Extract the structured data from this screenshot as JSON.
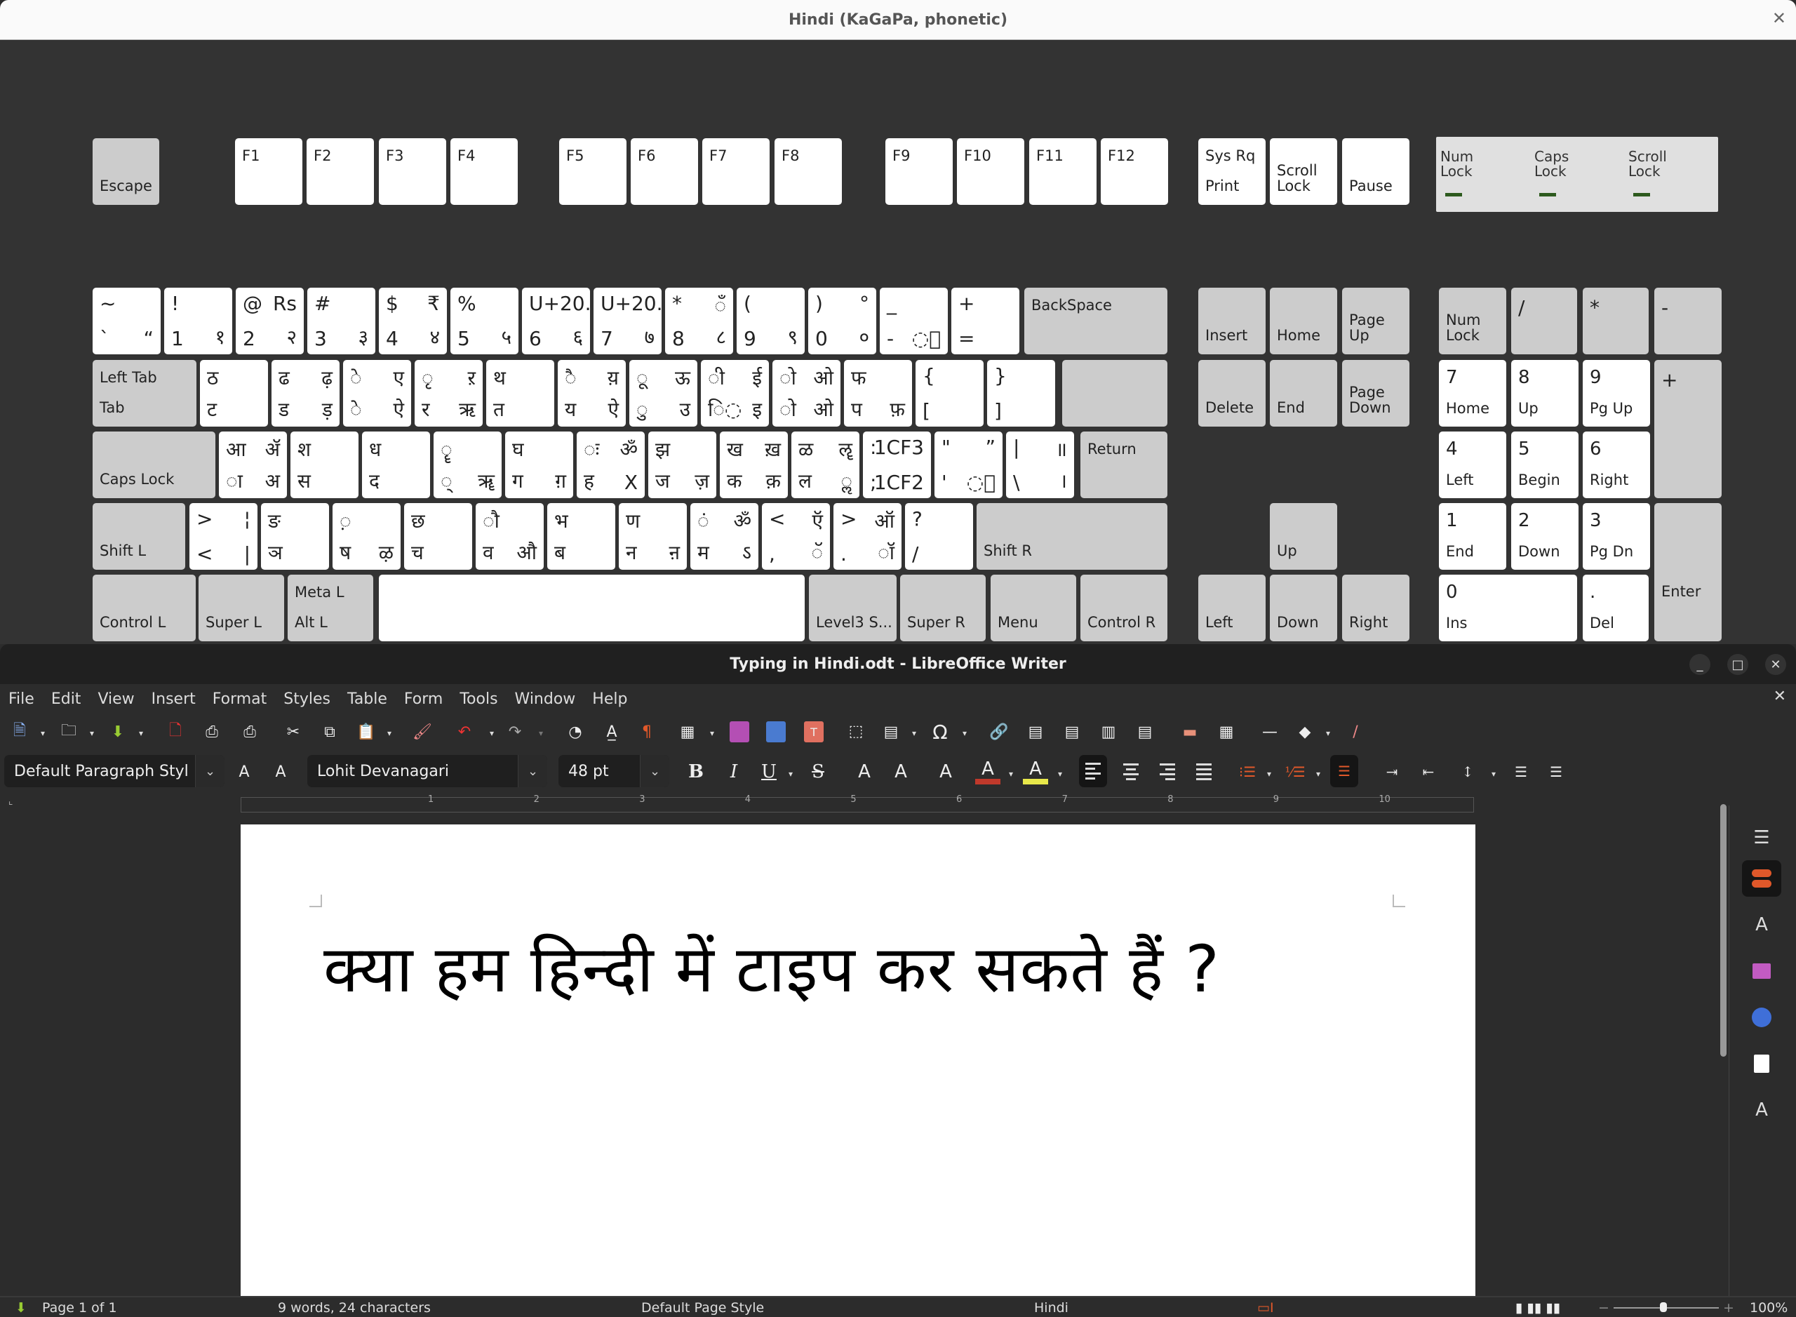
{
  "keyboard_window": {
    "title": "Hindi (KaGaPa, phonetic)",
    "close_icon": "close-icon",
    "function_row": [
      "Escape",
      "F1",
      "F2",
      "F3",
      "F4",
      "F5",
      "F6",
      "F7",
      "F8",
      "F9",
      "F10",
      "F11",
      "F12"
    ],
    "sys_keys": [
      {
        "top": "Sys Rq",
        "bottom": "Print"
      },
      {
        "top": "",
        "bottom": "Scroll\nLock"
      },
      {
        "top": "",
        "bottom": "Pause"
      }
    ],
    "leds": [
      {
        "label": "Num\nLock",
        "state": "off"
      },
      {
        "label": "Caps\nLock",
        "state": "off"
      },
      {
        "label": "Scroll\nLock",
        "state": "off"
      }
    ],
    "row_number": [
      {
        "tl": "~",
        "tr": "",
        "bl": "`",
        "br": "“"
      },
      {
        "tl": "!",
        "tr": "",
        "bl": "1",
        "br": "१"
      },
      {
        "tl": "@",
        "tr": "Rs",
        "bl": "2",
        "br": "२"
      },
      {
        "tl": "#",
        "tr": "",
        "bl": "3",
        "br": "३"
      },
      {
        "tl": "$",
        "tr": "₹",
        "bl": "4",
        "br": "४"
      },
      {
        "tl": "%",
        "tr": "",
        "bl": "5",
        "br": "५"
      },
      {
        "tl": "U+20...",
        "tr": "",
        "bl": "6",
        "br": "६"
      },
      {
        "tl": "U+20...",
        "tr": "",
        "bl": "7",
        "br": "७"
      },
      {
        "tl": "*",
        "tr": "◌ँ",
        "bl": "8",
        "br": "८"
      },
      {
        "tl": "(",
        "tr": "",
        "bl": "9",
        "br": "९"
      },
      {
        "tl": ")",
        "tr": "°",
        "bl": "0",
        "br": "०"
      },
      {
        "tl": "_",
        "tr": "",
        "bl": "-",
        "br": "◌॒"
      },
      {
        "tl": "+",
        "tr": "",
        "bl": "=",
        "br": ""
      }
    ],
    "backspace": "BackSpace",
    "tab_key": {
      "top": "Left Tab",
      "bottom": "Tab"
    },
    "row_tab": [
      {
        "tl": "ठ",
        "tr": "",
        "bl": "ट",
        "br": ""
      },
      {
        "tl": "ढ",
        "tr": "ढ़",
        "bl": "ड",
        "br": "ड़"
      },
      {
        "tl": "◌े",
        "tr": "ए",
        "bl": "◌े",
        "br": "ऐ"
      },
      {
        "tl": "◌ृ",
        "tr": "ऱ",
        "bl": "र",
        "br": "ऋ"
      },
      {
        "tl": "थ",
        "tr": "",
        "bl": "त",
        "br": ""
      },
      {
        "tl": "◌ै",
        "tr": "य़",
        "bl": "य",
        "br": "ऐ"
      },
      {
        "tl": "◌ू",
        "tr": "ऊ",
        "bl": "◌ु",
        "br": "उ"
      },
      {
        "tl": "◌ी",
        "tr": "ई",
        "bl": "ि◌",
        "br": "इ"
      },
      {
        "tl": "◌ो",
        "tr": "ओ",
        "bl": "◌ो",
        "br": "ओ"
      },
      {
        "tl": "फ",
        "tr": "",
        "bl": "प",
        "br": "फ़"
      },
      {
        "tl": "{",
        "tr": "",
        "bl": "[",
        "br": ""
      },
      {
        "tl": "}",
        "tr": "",
        "bl": "]",
        "br": ""
      }
    ],
    "return": "Return",
    "caps_lock": "Caps Lock",
    "row_caps": [
      {
        "tl": "आ",
        "tr": "ॲ",
        "bl": "◌ा",
        "br": "अ"
      },
      {
        "tl": "श",
        "tr": "",
        "bl": "स",
        "br": ""
      },
      {
        "tl": "ध",
        "tr": "",
        "bl": "द",
        "br": ""
      },
      {
        "tl": "◌ॄ",
        "tr": "",
        "bl": "◌्",
        "br": "ॠ"
      },
      {
        "tl": "घ",
        "tr": "",
        "bl": "ग",
        "br": "ग़"
      },
      {
        "tl": "◌ः",
        "tr": "ॐ",
        "bl": "ह",
        "br": "X"
      },
      {
        "tl": "झ",
        "tr": "",
        "bl": "ज",
        "br": "ज़"
      },
      {
        "tl": "ख",
        "tr": "ख़",
        "bl": "क",
        "br": "क़"
      },
      {
        "tl": "ळ",
        "tr": "ॡ",
        "bl": "ल",
        "br": "◌ॢ"
      },
      {
        "tl": ":",
        "tr": "1CF3",
        "bl": ";",
        "br": "1CF2"
      },
      {
        "tl": "\"",
        "tr": "”",
        "bl": "'",
        "br": "◌॑"
      },
      {
        "tl": "|",
        "tr": "॥",
        "bl": "\\",
        "br": "।"
      }
    ],
    "shift_l": "Shift L",
    "row_shift": [
      {
        "tl": ">",
        "tr": "¦",
        "bl": "<",
        "br": "|"
      },
      {
        "tl": "ङ",
        "tr": "",
        "bl": "ञ",
        "br": ""
      },
      {
        "tl": "◌़",
        "tr": "",
        "bl": "ष",
        "br": "ऴ"
      },
      {
        "tl": "छ",
        "tr": "",
        "bl": "च",
        "br": ""
      },
      {
        "tl": "◌ौ",
        "tr": "",
        "bl": "व",
        "br": "औ"
      },
      {
        "tl": "भ",
        "tr": "",
        "bl": "ब",
        "br": ""
      },
      {
        "tl": "ण",
        "tr": "",
        "bl": "न",
        "br": "ऩ"
      },
      {
        "tl": "◌ं",
        "tr": "ॐ",
        "bl": "म",
        "br": "ऽ"
      },
      {
        "tl": "<",
        "tr": "ऍ",
        "bl": ",",
        "br": "◌ॅ"
      },
      {
        "tl": ">",
        "tr": "ऑ",
        "bl": ".",
        "br": "◌ॉ"
      },
      {
        "tl": "?",
        "tr": "",
        "bl": "/",
        "br": ""
      }
    ],
    "shift_r": "Shift R",
    "bottom_row": {
      "control_l": "Control L",
      "super_l": "Super L",
      "meta_l": "Meta L",
      "alt_l": "Alt L",
      "level3": "Level3 S...",
      "super_r": "Super R",
      "menu": "Menu",
      "control_r": "Control R"
    },
    "nav": {
      "insert": "Insert",
      "home": "Home",
      "page_up": "Page\nUp",
      "delete": "Delete",
      "end": "End",
      "page_down": "Page\nDown",
      "up": "Up",
      "left": "Left",
      "down": "Down",
      "right": "Right"
    },
    "numpad": {
      "num_lock": "Num\nLock",
      "divide": "/",
      "multiply": "*",
      "minus": "-",
      "plus": "+",
      "enter": "Enter",
      "keys": [
        {
          "top": "7",
          "bottom": "Home"
        },
        {
          "top": "8",
          "bottom": "Up"
        },
        {
          "top": "9",
          "bottom": "Pg Up"
        },
        {
          "top": "4",
          "bottom": "Left"
        },
        {
          "top": "5",
          "bottom": "Begin"
        },
        {
          "top": "6",
          "bottom": "Right"
        },
        {
          "top": "1",
          "bottom": "End"
        },
        {
          "top": "2",
          "bottom": "Down"
        },
        {
          "top": "3",
          "bottom": "Pg Dn"
        },
        {
          "top": "0",
          "bottom": "Ins"
        },
        {
          "top": ".",
          "bottom": "Del"
        }
      ]
    }
  },
  "writer": {
    "title": "Typing in Hindi.odt - LibreOffice Writer",
    "menu": [
      "File",
      "Edit",
      "View",
      "Insert",
      "Format",
      "Styles",
      "Table",
      "Form",
      "Tools",
      "Window",
      "Help"
    ],
    "paragraph_style": "Default Paragraph Styl",
    "font_name": "Lohit Devanagari",
    "font_size": "48 pt",
    "format_buttons": {
      "bold": "B",
      "italic": "I",
      "underline": "U",
      "strike": "S"
    },
    "ruler_numbers": [
      "1",
      "2",
      "3",
      "4",
      "5",
      "6",
      "7",
      "8",
      "9",
      "10"
    ],
    "document_text": "क्या हम हिन्दी में टाइप कर सकते हैं ?",
    "status": {
      "page": "Page 1 of 1",
      "word_count": "9 words, 24 characters",
      "page_style": "Default Page Style",
      "language": "Hindi",
      "zoom": "100%"
    },
    "colors": {
      "font_color": "#c0392b",
      "highlight_color": "#e8e84a",
      "accent": "#e0582a"
    }
  }
}
